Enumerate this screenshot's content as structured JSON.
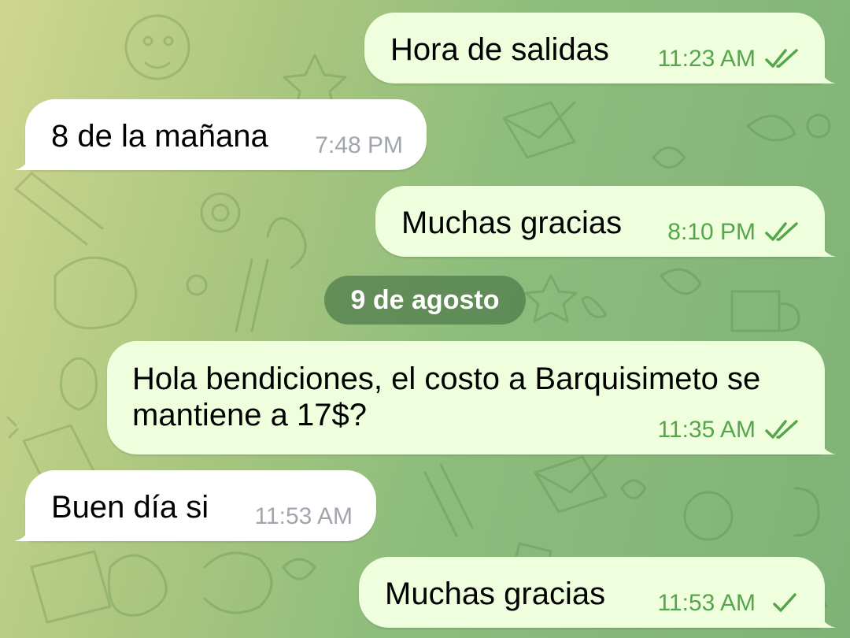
{
  "chat": {
    "date_separator": "9 de agosto",
    "messages": [
      {
        "direction": "outgoing",
        "text": "Hora de salidas",
        "time": "11:23 AM",
        "status": "read"
      },
      {
        "direction": "incoming",
        "text": "8 de la mañana",
        "time": "7:48 PM"
      },
      {
        "direction": "outgoing",
        "text": "Muchas gracias",
        "time": "8:10 PM",
        "status": "read"
      },
      {
        "direction": "outgoing",
        "text": "Hola bendiciones, el costo a Barquisimeto se mantiene a 17$?",
        "time": "11:35 AM",
        "status": "read"
      },
      {
        "direction": "incoming",
        "text": "Buen día si",
        "time": "11:53 AM"
      },
      {
        "direction": "outgoing",
        "text": "Muchas gracias",
        "time": "11:53 AM",
        "status": "sent"
      }
    ]
  },
  "icons": {
    "read_status": "double-check-icon",
    "sent_status": "single-check-icon"
  },
  "colors": {
    "outgoing_bubble": "#efffde",
    "incoming_bubble": "#ffffff",
    "outgoing_meta": "#55a64a",
    "incoming_meta": "#a0a6ad",
    "date_pill": "#4e784a"
  }
}
